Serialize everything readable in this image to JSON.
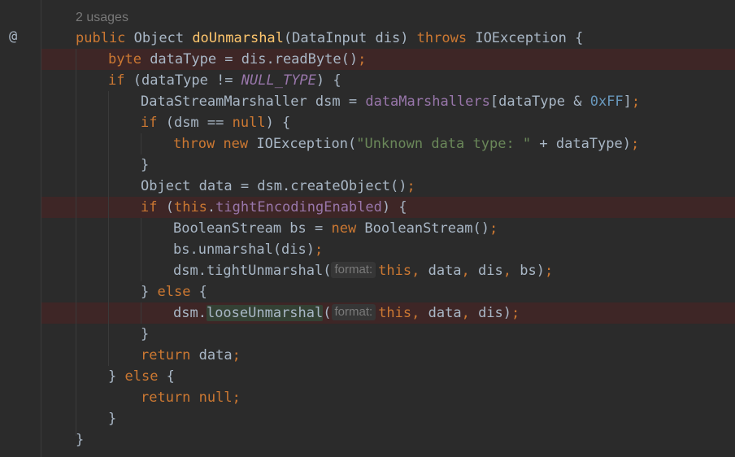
{
  "editor": {
    "gutter_marker": "@",
    "usages": "2 usages",
    "method": {
      "kw_public": "public",
      "return_type": " Object ",
      "name": "doUnmarshal",
      "params": "(DataInput dis) ",
      "kw_throws": "throws",
      "exception": " IOException {"
    },
    "l2": {
      "kw": "byte",
      "rest": " dataType = dis.readByte()",
      "semi": ";"
    },
    "l3": {
      "kw": "if",
      "pre": " (dataType != ",
      "const": "NULL_TYPE",
      "post": ") {"
    },
    "l4": {
      "pre": "DataStreamMarshaller dsm = ",
      "field": "dataMarshallers",
      "mid": "[dataType & ",
      "num": "0xFF",
      "post": "]",
      "semi": ";"
    },
    "l5": {
      "kw": "if",
      "pre": " (dsm == ",
      "kw_null": "null",
      "post": ") {"
    },
    "l6": {
      "kw_throw": "throw",
      "kw_new": "new",
      "pre": " IOException(",
      "str": "\"Unknown data type: \"",
      "post": " + dataType)",
      "semi": ";"
    },
    "l7": {
      "text": "}"
    },
    "l8": {
      "text": "Object data = dsm.createObject()",
      "semi": ";"
    },
    "l9": {
      "kw": "if",
      "pre": " (",
      "kw_this": "this",
      "dot": ".",
      "field": "tightEncodingEnabled",
      "post": ") {"
    },
    "l10": {
      "pre": "BooleanStream bs = ",
      "kw_new": "new",
      "post": " BooleanStream()",
      "semi": ";"
    },
    "l11": {
      "text": "bs.unmarshal(dis)",
      "semi": ";"
    },
    "l12": {
      "pre": "dsm.tightUnmarshal(",
      "hint": "format:",
      "kw_this": "this",
      "c1": ",",
      "a1": " data",
      "c2": ",",
      "a2": " dis",
      "c3": ",",
      "a3": " bs)",
      "semi": ";"
    },
    "l13": {
      "pre": "} ",
      "kw": "else",
      "post": " {"
    },
    "l14": {
      "pre": "dsm.",
      "method": "looseUnmarshal",
      "paren": "(",
      "hint": "format:",
      "kw_this": "this",
      "c1": ",",
      "a1": " data",
      "c2": ",",
      "a2": " dis)",
      "semi": ";"
    },
    "l15": {
      "text": "}"
    },
    "l16": {
      "kw": "return",
      "rest": " data",
      "semi": ";"
    },
    "l17": {
      "pre": "} ",
      "kw": "else",
      "post": " {"
    },
    "l18": {
      "kw": "return",
      "space": " ",
      "kw_null": "null",
      "semi": ";"
    },
    "l19": {
      "text": "}"
    },
    "l20": {
      "text": "}"
    }
  },
  "colors": {
    "background": "#2b2b2b",
    "keyword": "#cc7832",
    "method_decl": "#ffc66d",
    "field": "#9876aa",
    "number": "#6897bb",
    "string": "#6a8759",
    "text": "#a9b7c6",
    "error_row": "#3e2626"
  }
}
